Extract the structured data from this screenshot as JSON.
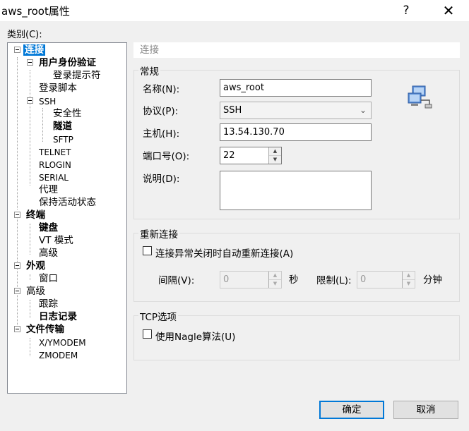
{
  "window": {
    "title": "aws_root属性",
    "help": "?",
    "close": "✕"
  },
  "category_label": "类别(C):",
  "tree": {
    "connection": "连接",
    "user_auth": "用户身份验证",
    "login_prompt": "登录提示符",
    "login_script": "登录脚本",
    "ssh": "SSH",
    "security": "安全性",
    "tunnel": "隧道",
    "sftp": "SFTP",
    "telnet": "TELNET",
    "rlogin": "RLOGIN",
    "serial": "SERIAL",
    "proxy": "代理",
    "keepalive": "保持活动状态",
    "terminal": "终端",
    "keyboard": "键盘",
    "vt_mode": "VT 模式",
    "advanced_terminal": "高级",
    "appearance": "外观",
    "window_item": "窗口",
    "advanced": "高级",
    "trace": "跟踪",
    "logging": "日志记录",
    "file_transfer": "文件传输",
    "xymodem": "X/YMODEM",
    "zmodem": "ZMODEM"
  },
  "section_header": "连接",
  "general": {
    "title": "常规",
    "name_label": "名称(N):",
    "name_value": "aws_root",
    "protocol_label": "协议(P):",
    "protocol_value": "SSH",
    "host_label": "主机(H):",
    "host_value": "13.54.130.70",
    "port_label": "端口号(O):",
    "port_value": "22",
    "desc_label": "说明(D):",
    "desc_value": ""
  },
  "reconnect": {
    "title": "重新连接",
    "auto_label": "连接异常关闭时自动重新连接(A)",
    "interval_label": "间隔(V):",
    "interval_value": "0",
    "sec_unit": "秒",
    "limit_label": "限制(L):",
    "limit_value": "0",
    "min_unit": "分钟"
  },
  "tcp": {
    "title": "TCP选项",
    "nagle_label": "使用Nagle算法(U)"
  },
  "buttons": {
    "ok": "确定",
    "cancel": "取消"
  }
}
